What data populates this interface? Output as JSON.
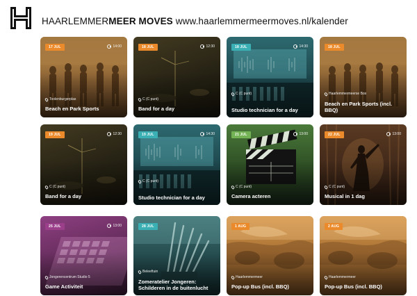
{
  "header": {
    "brand_light": "HAARLEMMER",
    "brand_bold": "MEER MOVES",
    "url": "www.haarlemmermeermoves.nl/kalender"
  },
  "colors": {
    "orange": "#ea8a2a",
    "teal": "#3ab0b4",
    "green": "#73b355",
    "purple": "#9b3f8b",
    "dark": "#1c1c1c",
    "brown": "#5a3a22"
  },
  "events": [
    {
      "date": "17 JUL",
      "time": "14:00",
      "location": "Toolenburgerplas",
      "title": "Beach en Park Sports",
      "badge": "orange",
      "theme": "sports"
    },
    {
      "date": "18 JUL",
      "time": "12:30",
      "location": "C (C punt)",
      "title": "Band for a day",
      "badge": "orange",
      "theme": "band"
    },
    {
      "date": "18 JUL",
      "time": "14:30",
      "location": "C (C punt)",
      "title": "Studio technician for a day",
      "badge": "teal",
      "theme": "studio"
    },
    {
      "date": "18 JUL",
      "time": "",
      "location": "Haarlemmermeerse Bos",
      "title": "Beach en Park Sports (incl. BBQ)",
      "badge": "orange",
      "theme": "sports"
    },
    {
      "date": "19 JUL",
      "time": "12:30",
      "location": "C (C punt)",
      "title": "Band for a day",
      "badge": "orange",
      "theme": "band"
    },
    {
      "date": "19 JUL",
      "time": "14:30",
      "location": "C (C punt)",
      "title": "Studio technician for a day",
      "badge": "teal",
      "theme": "studio"
    },
    {
      "date": "21 JUL",
      "time": "13:00",
      "location": "C (C punt)",
      "title": "Camera acteren",
      "badge": "green",
      "theme": "camera"
    },
    {
      "date": "22 JUL",
      "time": "13:00",
      "location": "C (C punt)",
      "title": "Musical in 1 dag",
      "badge": "orange",
      "theme": "musical"
    },
    {
      "date": "25 JUL",
      "time": "13:00",
      "location": "Jongerencentrum Studio 5",
      "title": "Game Activiteit",
      "badge": "purple",
      "theme": "game"
    },
    {
      "date": "28 JUL",
      "time": "",
      "location": "Beleeftuin",
      "title": "Zomeratelier Jongeren: Schilderen in de buitenlucht",
      "badge": "teal",
      "theme": "atelier"
    },
    {
      "date": "1 AUG",
      "time": "",
      "location": "Haarlemmermeer",
      "title": "Pop-up Bus (incl. BBQ)",
      "badge": "orange",
      "theme": "bus"
    },
    {
      "date": "2 AUG",
      "time": "",
      "location": "Haarlemmermeer",
      "title": "Pop-up Bus (incl. BBQ)",
      "badge": "orange",
      "theme": "bus"
    }
  ]
}
